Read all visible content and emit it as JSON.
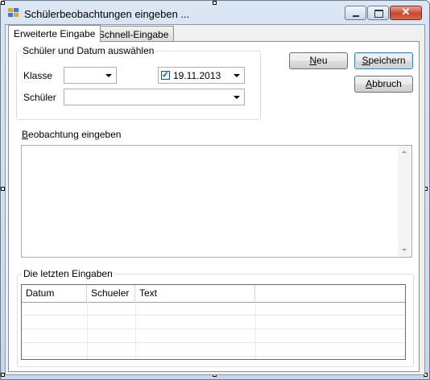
{
  "window": {
    "title": "Schülerbeobachtungen eingeben ..."
  },
  "tabs": [
    {
      "label": "Erweiterte Eingabe",
      "active": true
    },
    {
      "label": "Schnell-Eingabe",
      "active": false
    }
  ],
  "select_group": {
    "title": "Schüler und Datum auswählen",
    "klasse_label": "Klasse",
    "klasse_value": "",
    "schueler_label": "Schüler",
    "schueler_value": "",
    "date_checked": true,
    "date_value": "19.11.2013"
  },
  "buttons": {
    "neu_first": "N",
    "neu_rest": "eu",
    "speichern_first": "S",
    "speichern_rest": "peichern",
    "abbruch_first": "A",
    "abbruch_rest": "bbruch"
  },
  "observation_group": {
    "title_first": "B",
    "title_rest": "eobachtung eingeben",
    "text": ""
  },
  "recent_group": {
    "title": "Die letzten Eingaben",
    "columns": [
      "Datum",
      "Schueler",
      "Text"
    ]
  },
  "icons": {
    "app": "app-icon",
    "minimize": "minimize-icon",
    "maximize": "maximize-icon",
    "close": "close-icon",
    "close_glyph": "✕",
    "check_glyph": "✓"
  }
}
